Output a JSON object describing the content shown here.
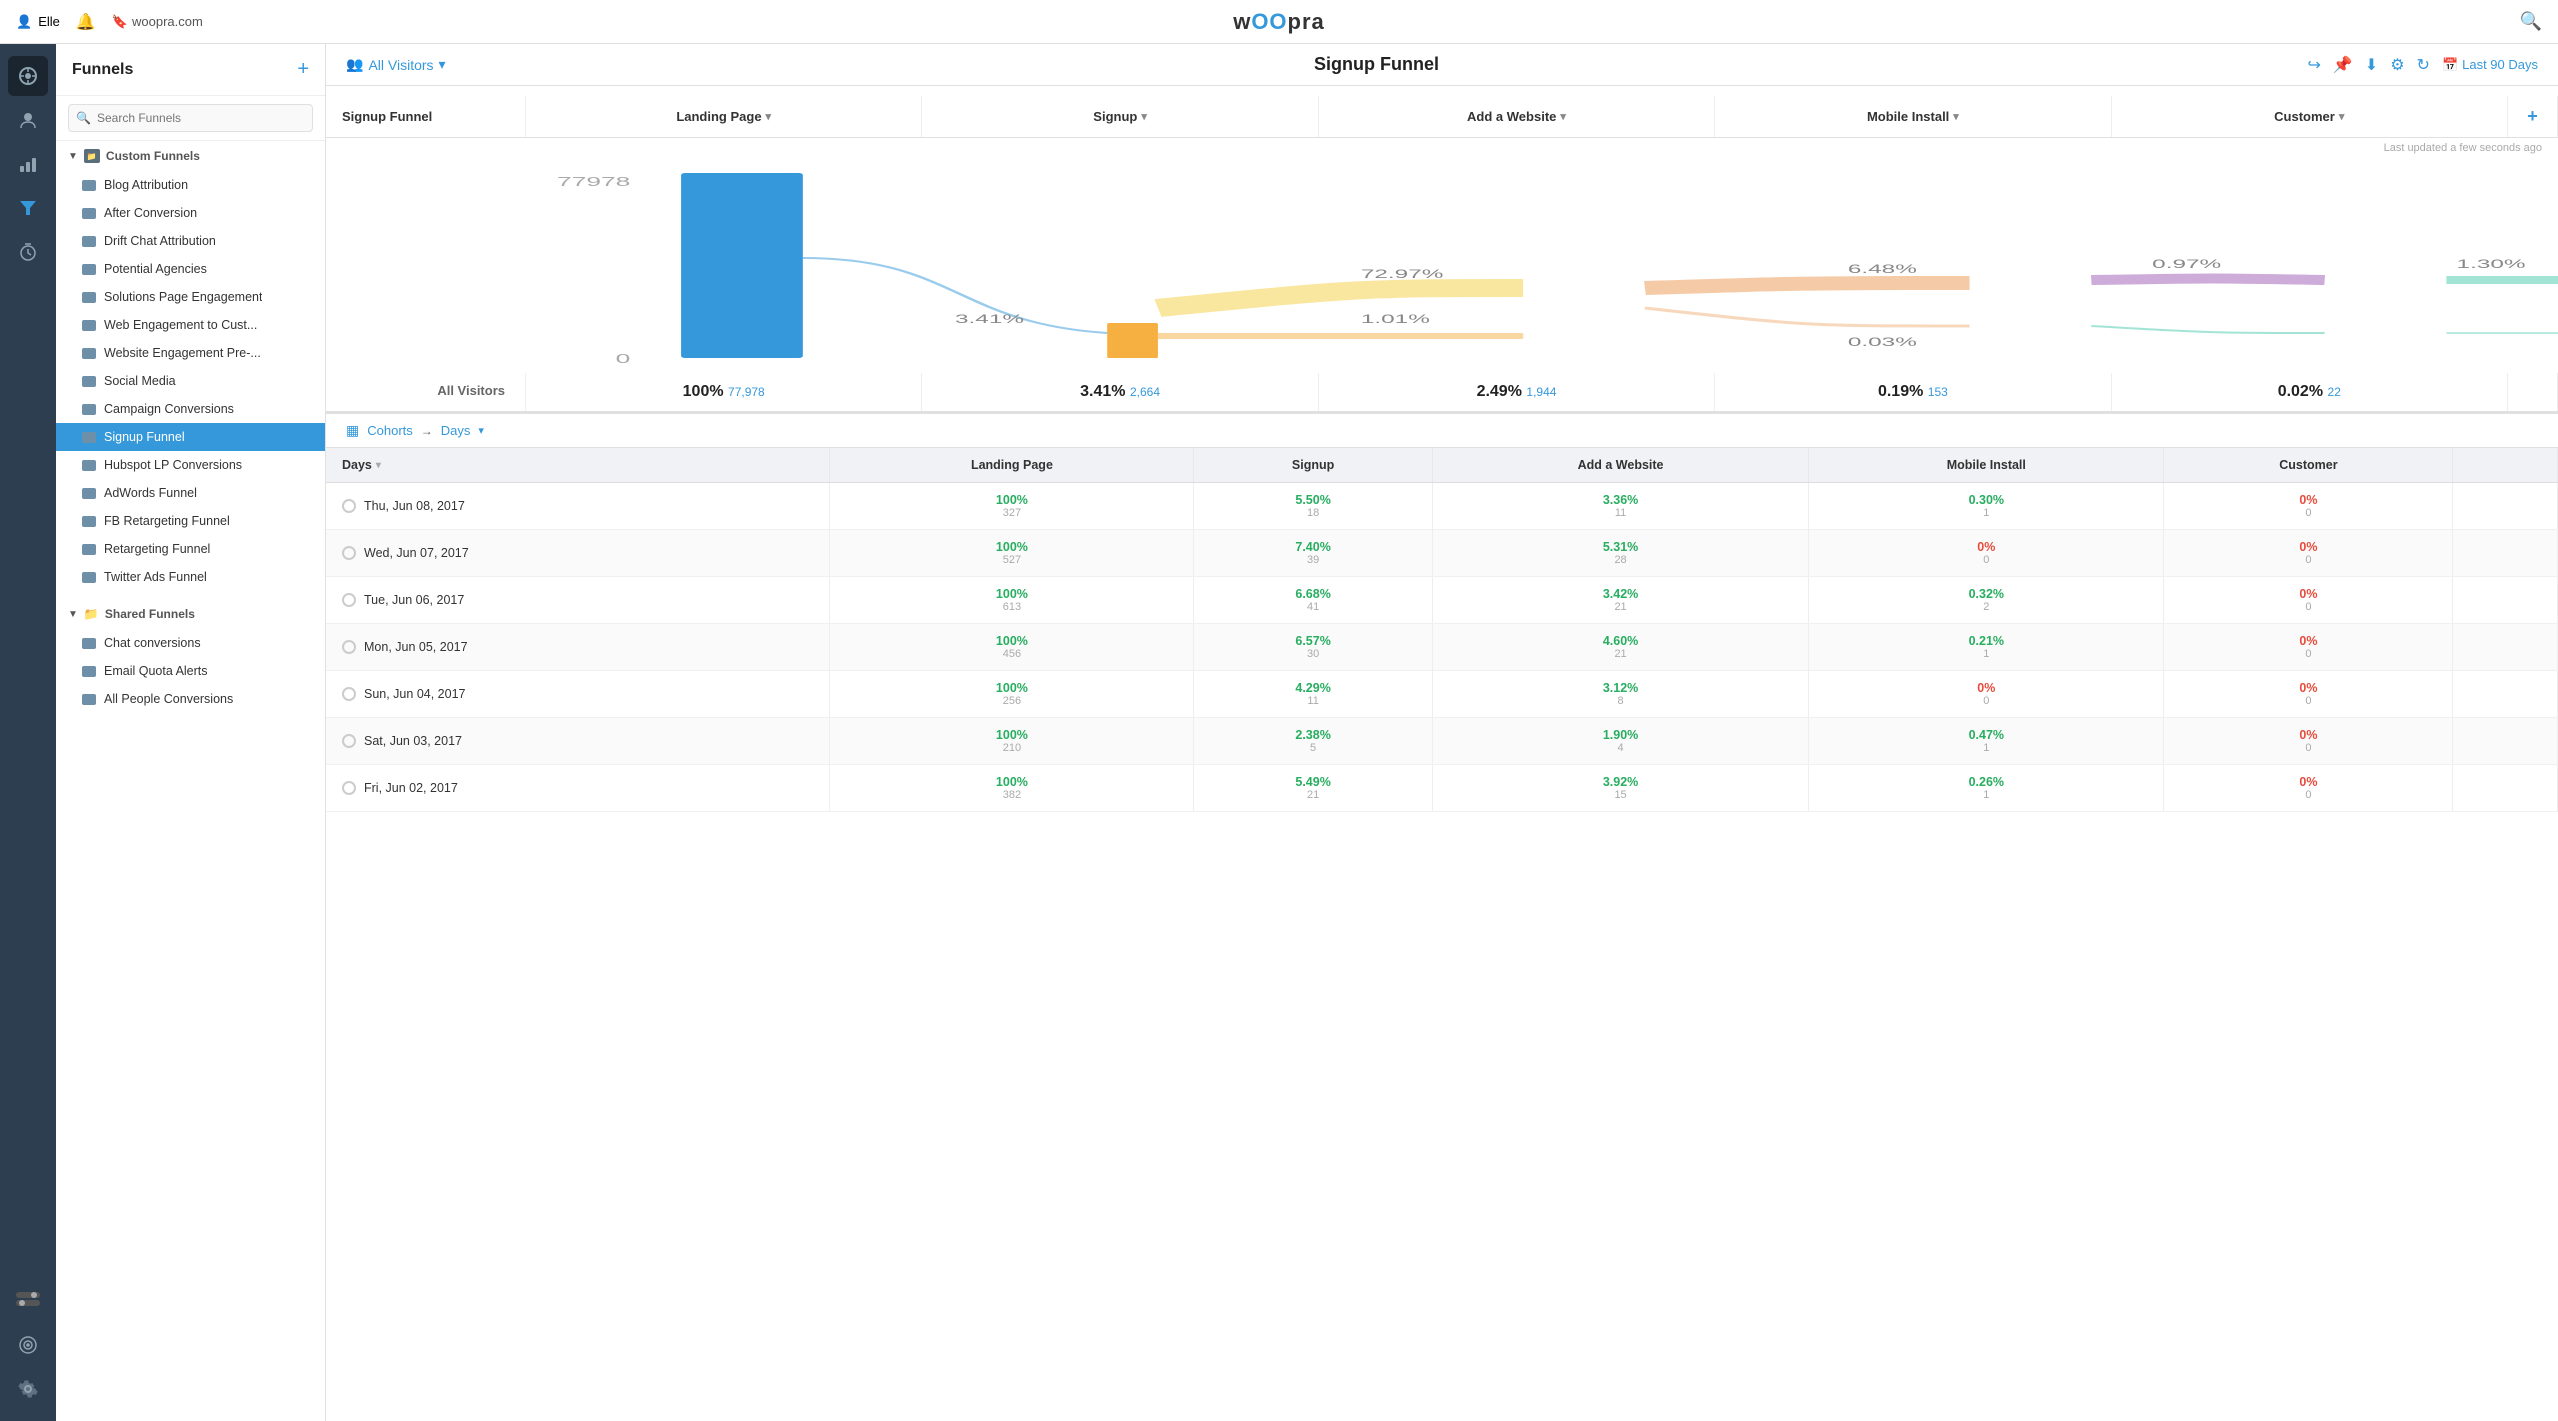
{
  "topnav": {
    "user": "Elle",
    "bell_label": "notifications",
    "domain": "woopra.com",
    "logo": "wOOpra",
    "search_icon": "search"
  },
  "sidebar": {
    "title": "Funnels",
    "add_label": "+",
    "search_placeholder": "Search Funnels",
    "custom_group": "Custom Funnels",
    "shared_group": "Shared Funnels",
    "custom_items": [
      "Blog Attribution",
      "After Conversion",
      "Drift Chat Attribution",
      "Potential Agencies",
      "Solutions Page Engagement",
      "Web Engagement to Cust...",
      "Website Engagement Pre-...",
      "Social Media",
      "Campaign Conversions",
      "Signup Funnel",
      "Hubspot LP Conversions",
      "AdWords Funnel",
      "FB Retargeting Funnel",
      "Retargeting Funnel",
      "Twitter Ads Funnel"
    ],
    "shared_items": [
      "Chat conversions",
      "Email Quota Alerts",
      "All People Conversions"
    ]
  },
  "funnel_header": {
    "all_visitors_label": "All Visitors",
    "title": "Signup Funnel",
    "last_updated": "Last updated a few seconds ago",
    "date_range": "Last 90 Days",
    "icons": [
      "share",
      "pin",
      "download",
      "settings",
      "refresh",
      "calendar"
    ]
  },
  "funnel_columns": {
    "col0": "Signup Funnel",
    "col1": "Landing Page",
    "col2": "Signup",
    "col3": "Add a Website",
    "col4": "Mobile Install",
    "col5": "Customer",
    "col1_dropdown": true,
    "col2_dropdown": true,
    "col3_dropdown": true,
    "col4_dropdown": true,
    "col5_dropdown": true
  },
  "funnel_summary": {
    "label": "All Visitors",
    "col0_pct": "100%",
    "col0_count": "77,978",
    "col1_pct": "3.41%",
    "col1_count": "2,664",
    "col2_pct": "2.49%",
    "col2_count": "1,944",
    "col3_pct": "0.19%",
    "col3_count": "153",
    "col4_pct": "0.02%",
    "col4_count": "22"
  },
  "chart": {
    "top_value": "77978",
    "bottom_value": "0",
    "pct_landing": "3.41%",
    "pct_signup_top": "72.97%",
    "pct_signup_bot": "1.01%",
    "pct_website_top": "6.48%",
    "pct_website_bot": "0.03%",
    "pct_mobile_top": "0.97%",
    "pct_customer": "1.30%"
  },
  "cohorts": {
    "label": "Cohorts",
    "arrow": "→",
    "period": "Days"
  },
  "table": {
    "col_days": "Days",
    "col_landing": "Landing Page",
    "col_signup": "Signup",
    "col_website": "Add a Website",
    "col_mobile": "Mobile Install",
    "col_customer": "Customer",
    "rows": [
      {
        "date": "Thu, Jun 08, 2017",
        "landing_pct": "100%",
        "landing_n": "327",
        "signup_pct": "5.50%",
        "signup_n": "18",
        "signup_color": "green",
        "website_pct": "3.36%",
        "website_n": "11",
        "website_color": "green",
        "mobile_pct": "0.30%",
        "mobile_n": "1",
        "mobile_color": "green",
        "customer_pct": "0%",
        "customer_n": "0",
        "customer_color": "red"
      },
      {
        "date": "Wed, Jun 07, 2017",
        "landing_pct": "100%",
        "landing_n": "527",
        "signup_pct": "7.40%",
        "signup_n": "39",
        "signup_color": "green",
        "website_pct": "5.31%",
        "website_n": "28",
        "website_color": "green",
        "mobile_pct": "0%",
        "mobile_n": "0",
        "mobile_color": "red",
        "customer_pct": "0%",
        "customer_n": "0",
        "customer_color": "red"
      },
      {
        "date": "Tue, Jun 06, 2017",
        "landing_pct": "100%",
        "landing_n": "613",
        "signup_pct": "6.68%",
        "signup_n": "41",
        "signup_color": "green",
        "website_pct": "3.42%",
        "website_n": "21",
        "website_color": "green",
        "mobile_pct": "0.32%",
        "mobile_n": "2",
        "mobile_color": "green",
        "customer_pct": "0%",
        "customer_n": "0",
        "customer_color": "red"
      },
      {
        "date": "Mon, Jun 05, 2017",
        "landing_pct": "100%",
        "landing_n": "456",
        "signup_pct": "6.57%",
        "signup_n": "30",
        "signup_color": "green",
        "website_pct": "4.60%",
        "website_n": "21",
        "website_color": "green",
        "mobile_pct": "0.21%",
        "mobile_n": "1",
        "mobile_color": "green",
        "customer_pct": "0%",
        "customer_n": "0",
        "customer_color": "red"
      },
      {
        "date": "Sun, Jun 04, 2017",
        "landing_pct": "100%",
        "landing_n": "256",
        "signup_pct": "4.29%",
        "signup_n": "11",
        "signup_color": "green",
        "website_pct": "3.12%",
        "website_n": "8",
        "website_color": "green",
        "mobile_pct": "0%",
        "mobile_n": "0",
        "mobile_color": "red",
        "customer_pct": "0%",
        "customer_n": "0",
        "customer_color": "red"
      },
      {
        "date": "Sat, Jun 03, 2017",
        "landing_pct": "100%",
        "landing_n": "210",
        "signup_pct": "2.38%",
        "signup_n": "5",
        "signup_color": "green",
        "website_pct": "1.90%",
        "website_n": "4",
        "website_color": "green",
        "mobile_pct": "0.47%",
        "mobile_n": "1",
        "mobile_color": "green",
        "customer_pct": "0%",
        "customer_n": "0",
        "customer_color": "red"
      },
      {
        "date": "Fri, Jun 02, 2017",
        "landing_pct": "100%",
        "landing_n": "382",
        "signup_pct": "5.49%",
        "signup_n": "21",
        "signup_color": "green",
        "website_pct": "3.92%",
        "website_n": "15",
        "website_color": "green",
        "mobile_pct": "0.26%",
        "mobile_n": "1",
        "mobile_color": "green",
        "customer_pct": "0%",
        "customer_n": "0",
        "customer_color": "red"
      }
    ]
  }
}
